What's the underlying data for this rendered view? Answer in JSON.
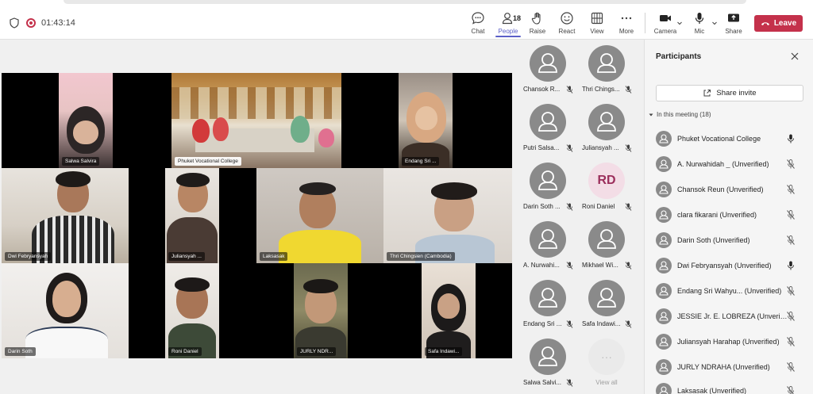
{
  "meeting": {
    "timer": "01:43:14"
  },
  "toolbar": {
    "chat": "Chat",
    "people": "People",
    "people_count": "18",
    "raise": "Raise",
    "react": "React",
    "view": "View",
    "more": "More",
    "camera": "Camera",
    "mic": "Mic",
    "share": "Share",
    "leave": "Leave"
  },
  "stage": {
    "tiles": [
      {
        "name": "Salwa Salvira"
      },
      {
        "name": "Phuket Vocational College"
      },
      {
        "name": "Endang Sri ..."
      },
      {
        "name": "Dwi Febryansyah"
      },
      {
        "name": "Juliansyah ..."
      },
      {
        "name": "Laksasak"
      },
      {
        "name": "Thri Chingsien (Cambodia)"
      },
      {
        "name": "Darin Soth"
      },
      {
        "name": "Roni Daniel"
      },
      {
        "name": "JURLY NDR..."
      },
      {
        "name": "Safa Indawi..."
      }
    ]
  },
  "thumbnails": [
    {
      "name": "Chansok R..."
    },
    {
      "name": "Thri Chings..."
    },
    {
      "name": "Putri Salsa..."
    },
    {
      "name": "Juliansyah ..."
    },
    {
      "name": "Darin Soth ..."
    },
    {
      "name": "Roni Daniel",
      "initials": "RD"
    },
    {
      "name": "A. Nurwahi..."
    },
    {
      "name": "Mikhael Wi..."
    },
    {
      "name": "Endang Sri ..."
    },
    {
      "name": "Safa Indawi..."
    },
    {
      "name": "Salwa Salvi..."
    },
    {
      "name": "View all",
      "more": "···"
    }
  ],
  "panel": {
    "title": "Participants",
    "share_invite": "Share invite",
    "section": "In this meeting (18)",
    "participants": [
      {
        "name": "Phuket Vocational College",
        "mic": "on"
      },
      {
        "name": "A. Nurwahidah _ (Unverified)",
        "mic": "muted"
      },
      {
        "name": "Chansok Reun (Unverified)",
        "mic": "muted"
      },
      {
        "name": "clara fikarani (Unverified)",
        "mic": "muted"
      },
      {
        "name": "Darin Soth (Unverified)",
        "mic": "muted"
      },
      {
        "name": "Dwi Febryansyah (Unverified)",
        "mic": "on"
      },
      {
        "name": "Endang Sri Wahyu... (Unverified)",
        "mic": "muted"
      },
      {
        "name": "JESSIE Jr. E. LOBREZA (Unverifi...",
        "mic": "muted"
      },
      {
        "name": "Juliansyah Harahap (Unverified)",
        "mic": "muted"
      },
      {
        "name": "JURLY NDRAHA (Unverified)",
        "mic": "muted"
      },
      {
        "name": "Laksasak (Unverified)",
        "mic": "muted"
      }
    ]
  }
}
